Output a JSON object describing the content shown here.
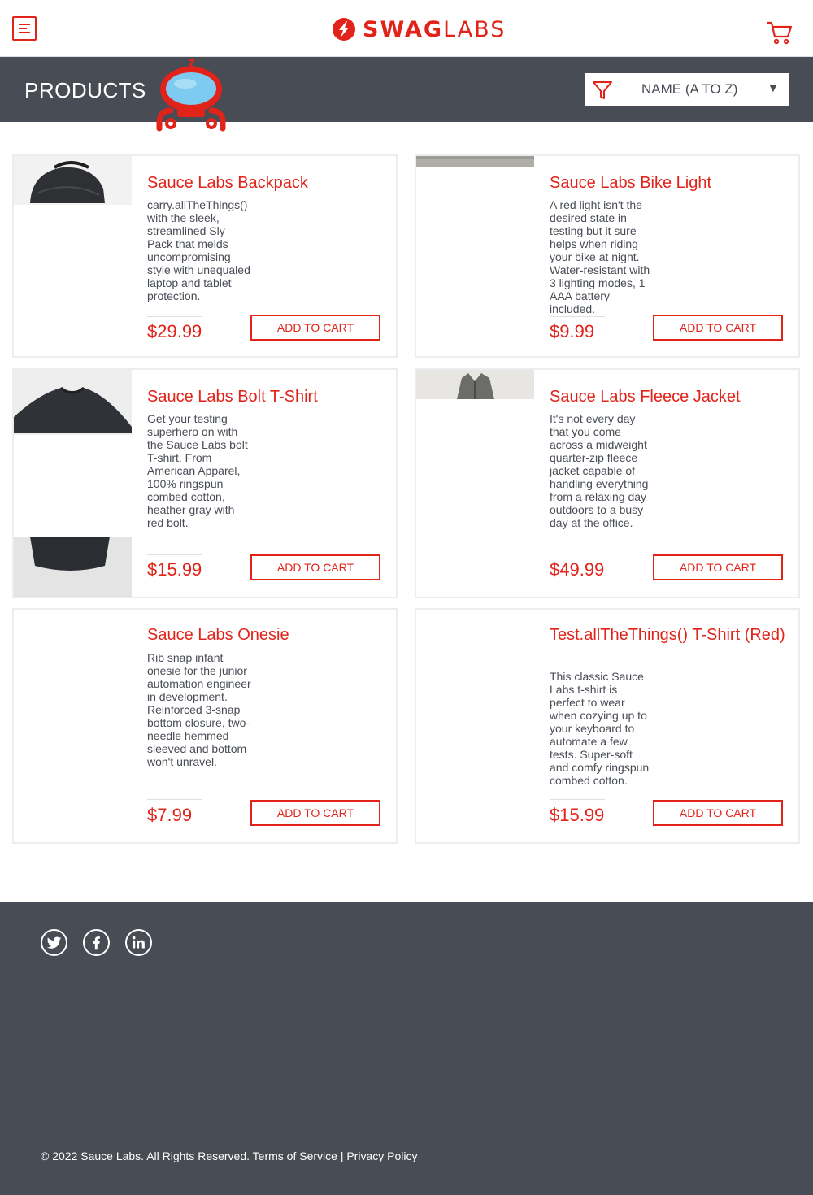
{
  "header": {
    "logo_bold": "SWAG",
    "logo_light": "LABS",
    "menu_icon": "hamburger-icon",
    "cart_icon": "shopping-cart-icon"
  },
  "subheader": {
    "title": "PRODUCTS",
    "sort_selected": "NAME (A TO Z)",
    "sort_caret": "▼",
    "filter_icon": "filter-icon"
  },
  "products": [
    {
      "name": "Sauce Labs Backpack",
      "description": "carry.allTheThings() with the sleek, streamlined Sly Pack that melds uncompromising style with unequaled laptop and tablet protection.",
      "price": "$29.99",
      "button": "ADD TO CART"
    },
    {
      "name": "Sauce Labs Bike Light",
      "description": "A red light isn't the desired state in testing but it sure helps when riding your bike at night. Water-resistant with 3 lighting modes, 1 AAA battery included.",
      "price": "$9.99",
      "button": "ADD TO CART"
    },
    {
      "name": "Sauce Labs Bolt T-Shirt",
      "description": "Get your testing superhero on with the Sauce Labs bolt T-shirt. From American Apparel, 100% ringspun combed cotton, heather gray with red bolt.",
      "price": "$15.99",
      "button": "ADD TO CART"
    },
    {
      "name": "Sauce Labs Fleece Jacket",
      "description": "It's not every day that you come across a midweight quarter-zip fleece jacket capable of handling everything from a relaxing day outdoors to a busy day at the office.",
      "price": "$49.99",
      "button": "ADD TO CART"
    },
    {
      "name": "Sauce Labs Onesie",
      "description": "Rib snap infant onesie for the junior automation engineer in development. Reinforced 3-snap bottom closure, two-needle hemmed sleeved and bottom won't unravel.",
      "price": "$7.99",
      "button": "ADD TO CART"
    },
    {
      "name": "Test.allTheThings() T-Shirt (Red)",
      "description": "This classic Sauce Labs t-shirt is perfect to wear when cozying up to your keyboard to automate a few tests. Super-soft and comfy ringspun combed cotton.",
      "price": "$15.99",
      "button": "ADD TO CART"
    }
  ],
  "footer": {
    "social": [
      "twitter-icon",
      "facebook-icon",
      "linkedin-icon"
    ],
    "copyright": "© 2022 Sauce Labs. All Rights Reserved.",
    "terms": "Terms of Service",
    "separator": "|",
    "privacy": "Privacy Policy"
  },
  "colors": {
    "accent": "#e2231a",
    "header_dark": "#474c55",
    "text": "#484c55"
  }
}
